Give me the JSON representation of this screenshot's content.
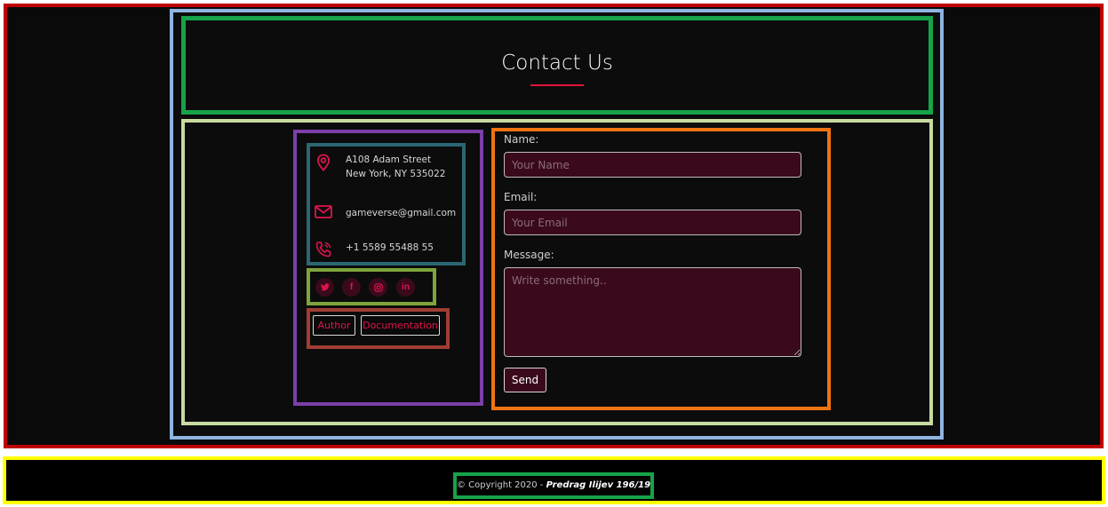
{
  "header": {
    "title": "Contact Us"
  },
  "contact_info": {
    "address_line1": "A108 Adam Street",
    "address_line2": "New York, NY 535022",
    "email": "gameverse@gmail.com",
    "phone": "+1 5589 55488 55"
  },
  "social": [
    {
      "icon": "twitter-icon",
      "glyph": "🐦"
    },
    {
      "icon": "facebook-icon",
      "glyph": "f"
    },
    {
      "icon": "instagram-icon",
      "glyph": "◎"
    },
    {
      "icon": "linkedin-icon",
      "glyph": "in"
    }
  ],
  "links": {
    "author_label": "Author",
    "documentation_label": "Documentation"
  },
  "form": {
    "name_label": "Name:",
    "name_placeholder": "Your Name",
    "email_label": "Email:",
    "email_placeholder": "Your Email",
    "message_label": "Message:",
    "message_placeholder": "Write something..",
    "send_label": "Send"
  },
  "footer": {
    "copyright": "© Copyright 2020 - ",
    "author": "Predrag Ilijev 196/19"
  },
  "colors": {
    "accent": "#e0144c",
    "field_bg": "#3a0a1c",
    "page_bg": "#0a0a0a"
  }
}
